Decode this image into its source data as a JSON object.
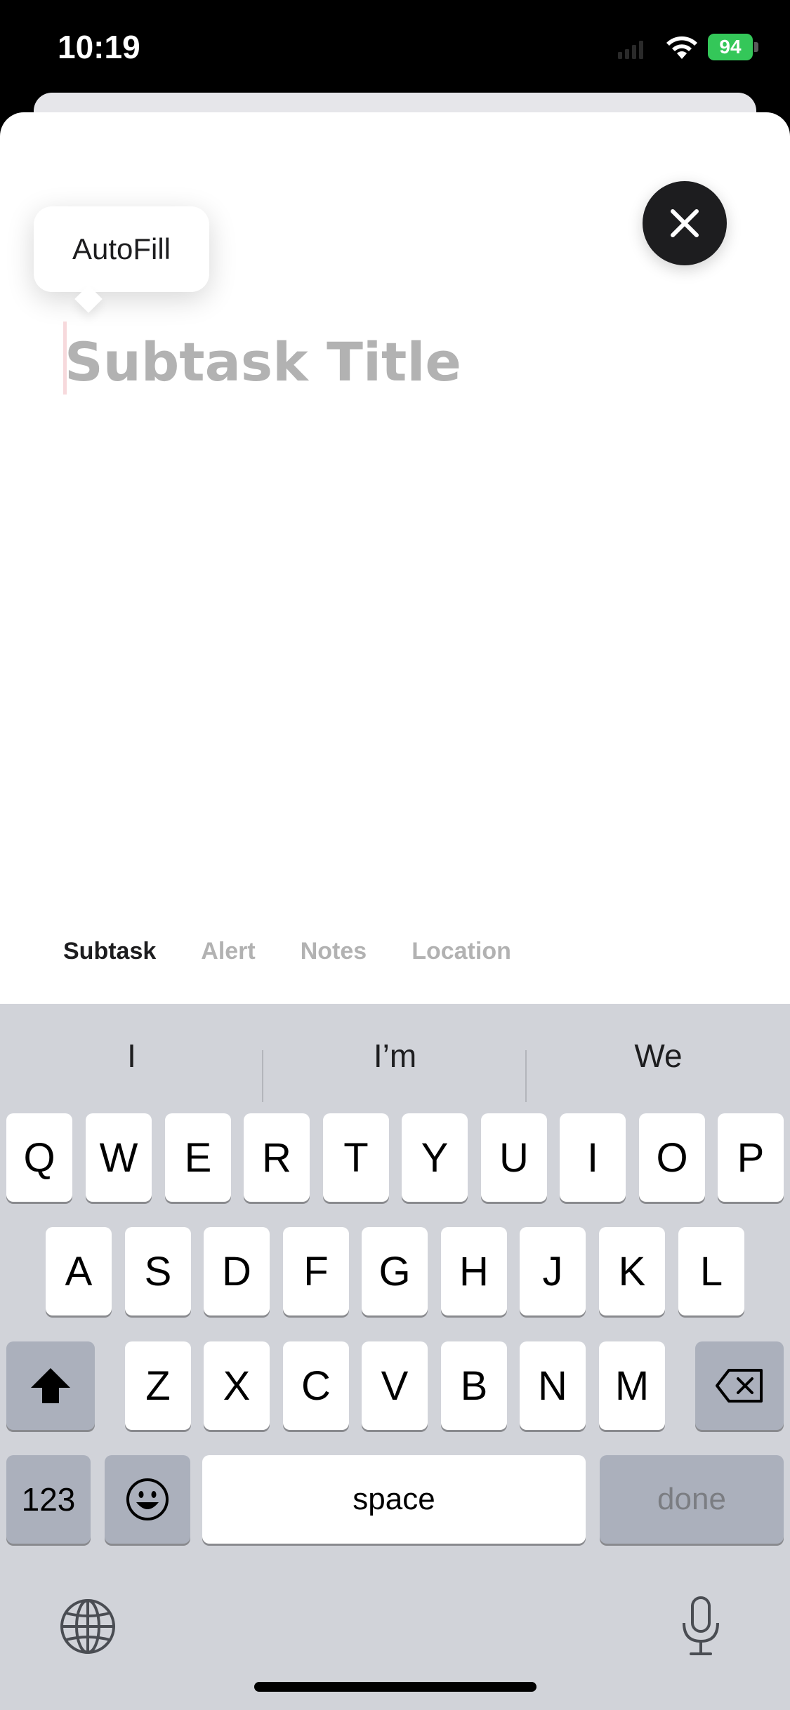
{
  "status_bar": {
    "time": "10:19",
    "battery": "94"
  },
  "sheet": {
    "autofill_label": "AutoFill",
    "title_placeholder": "Subtask Title",
    "tabs": [
      {
        "label": "Subtask",
        "active": true
      },
      {
        "label": "Alert",
        "active": false
      },
      {
        "label": "Notes",
        "active": false
      },
      {
        "label": "Location",
        "active": false
      }
    ]
  },
  "keyboard": {
    "suggestions": [
      "I",
      "I’m",
      "We"
    ],
    "row1": [
      "Q",
      "W",
      "E",
      "R",
      "T",
      "Y",
      "U",
      "I",
      "O",
      "P"
    ],
    "row2": [
      "A",
      "S",
      "D",
      "F",
      "G",
      "H",
      "J",
      "K",
      "L"
    ],
    "row3": [
      "Z",
      "X",
      "C",
      "V",
      "B",
      "N",
      "M"
    ],
    "numbers_label": "123",
    "space_label": "space",
    "done_label": "done"
  },
  "colors": {
    "battery": "#34c759",
    "keyboard_bg": "#d1d3d9",
    "close_button": "#1d1d1f"
  }
}
